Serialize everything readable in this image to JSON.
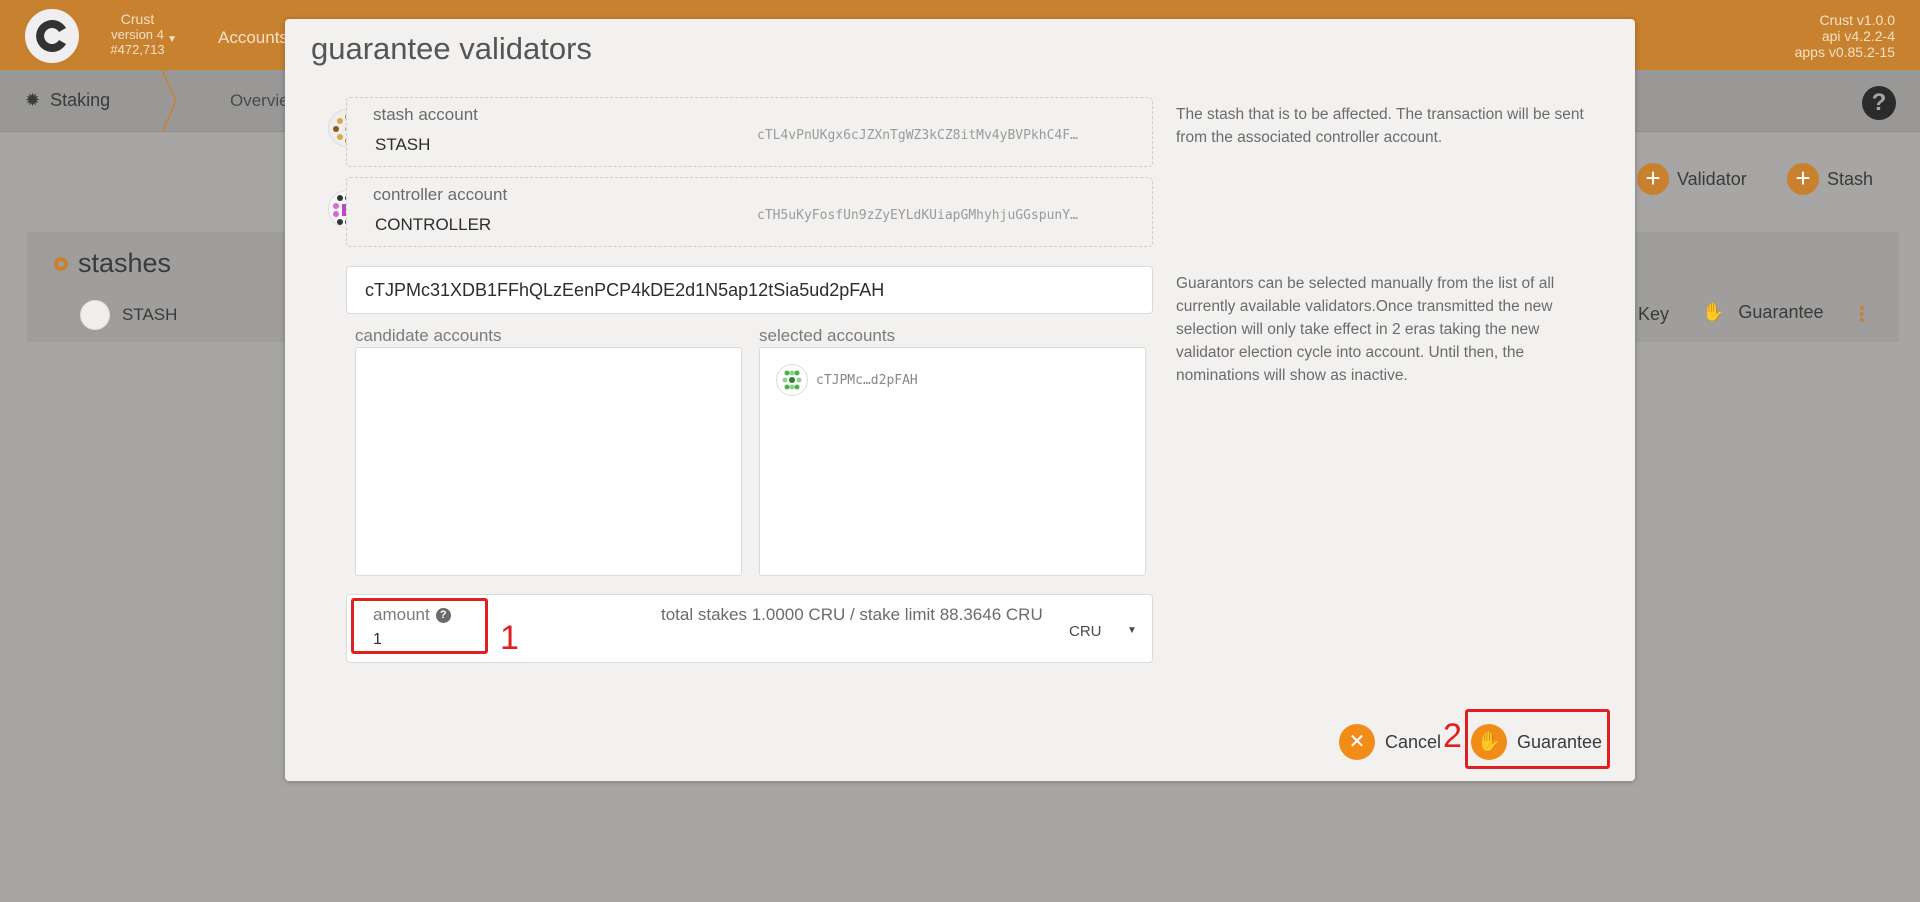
{
  "topbar": {
    "chain_name": "Crust",
    "chain_version": "version 4",
    "block_number": "#472,713",
    "nav_accounts": "Accounts",
    "version_lines": [
      "Crust v1.0.0",
      "api v4.2.2-4",
      "apps v0.85.2-15"
    ]
  },
  "subbar": {
    "app_name": "Staking",
    "tab_overview": "Overview"
  },
  "background": {
    "validator_btn": "Validator",
    "stash_btn": "Stash",
    "stashes_title": "stashes",
    "stash_row_name": "STASH",
    "key_label": "Key",
    "guarantee_label": "Guarantee"
  },
  "modal": {
    "title": "guarantee validators",
    "stash": {
      "label": "stash account",
      "name": "STASH",
      "address": "cTL4vPnUKgx6cJZXnTgWZ3kCZ8itMv4yBVPkhC4F…"
    },
    "controller": {
      "label": "controller account",
      "name": "CONTROLLER",
      "address": "cTH5uKyFosfUn9zZyEYLdKUiapGMhyhjuGGspunY…"
    },
    "help_stash": "The stash that is to be affected. The transaction will be sent from the associated controller account.",
    "guarantee_input_value": "cTJPMc31XDB1FFhQLzEenPCP4kDE2d1N5ap12tSia5ud2pFAH",
    "help_guarantors": "Guarantors can be selected manually from the list of all currently available validators.Once transmitted the new selection will only take effect in 2 eras taking the new validator election cycle into account. Until then, the nominations will show as inactive.",
    "candidate_label": "candidate accounts",
    "selected_label": "selected accounts",
    "selected_items": [
      "cTJPMc…d2pFAH"
    ],
    "amount": {
      "label": "amount",
      "value": "1",
      "stakes_text": "total stakes 1.0000 CRU / stake limit 88.3646 CRU",
      "unit": "CRU"
    },
    "cancel_label": "Cancel",
    "guarantee_label": "Guarantee"
  },
  "annotations": {
    "num1": "1",
    "num2": "2",
    "color": "#e02020"
  },
  "colors": {
    "accent": "#c8812f",
    "button_orange": "#f28c18"
  },
  "icons": [
    "crust-logo-icon",
    "caret-down-icon",
    "gear-icon",
    "help-icon",
    "plus-icon",
    "hand-icon",
    "close-icon",
    "kebab-icon",
    "question-icon",
    "identicon"
  ]
}
